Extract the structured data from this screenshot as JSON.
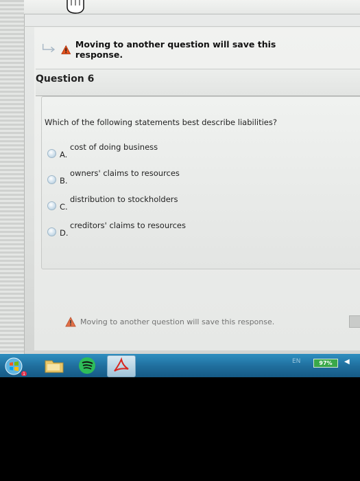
{
  "banner": {
    "warning_top": "Moving to another question will save this response.",
    "warning_bottom": "Moving to another question will save this response."
  },
  "question": {
    "title": "Question 6",
    "text": "Which of the following statements best describe liabilities?",
    "options": [
      {
        "letter": "A.",
        "text": "cost of doing business"
      },
      {
        "letter": "B.",
        "text": "owners' claims to resources"
      },
      {
        "letter": "C.",
        "text": "distribution to stockholders"
      },
      {
        "letter": "D.",
        "text": "creditors' claims to resources"
      }
    ]
  },
  "taskbar": {
    "language": "EN",
    "battery": "97%",
    "start_badge": "1"
  }
}
